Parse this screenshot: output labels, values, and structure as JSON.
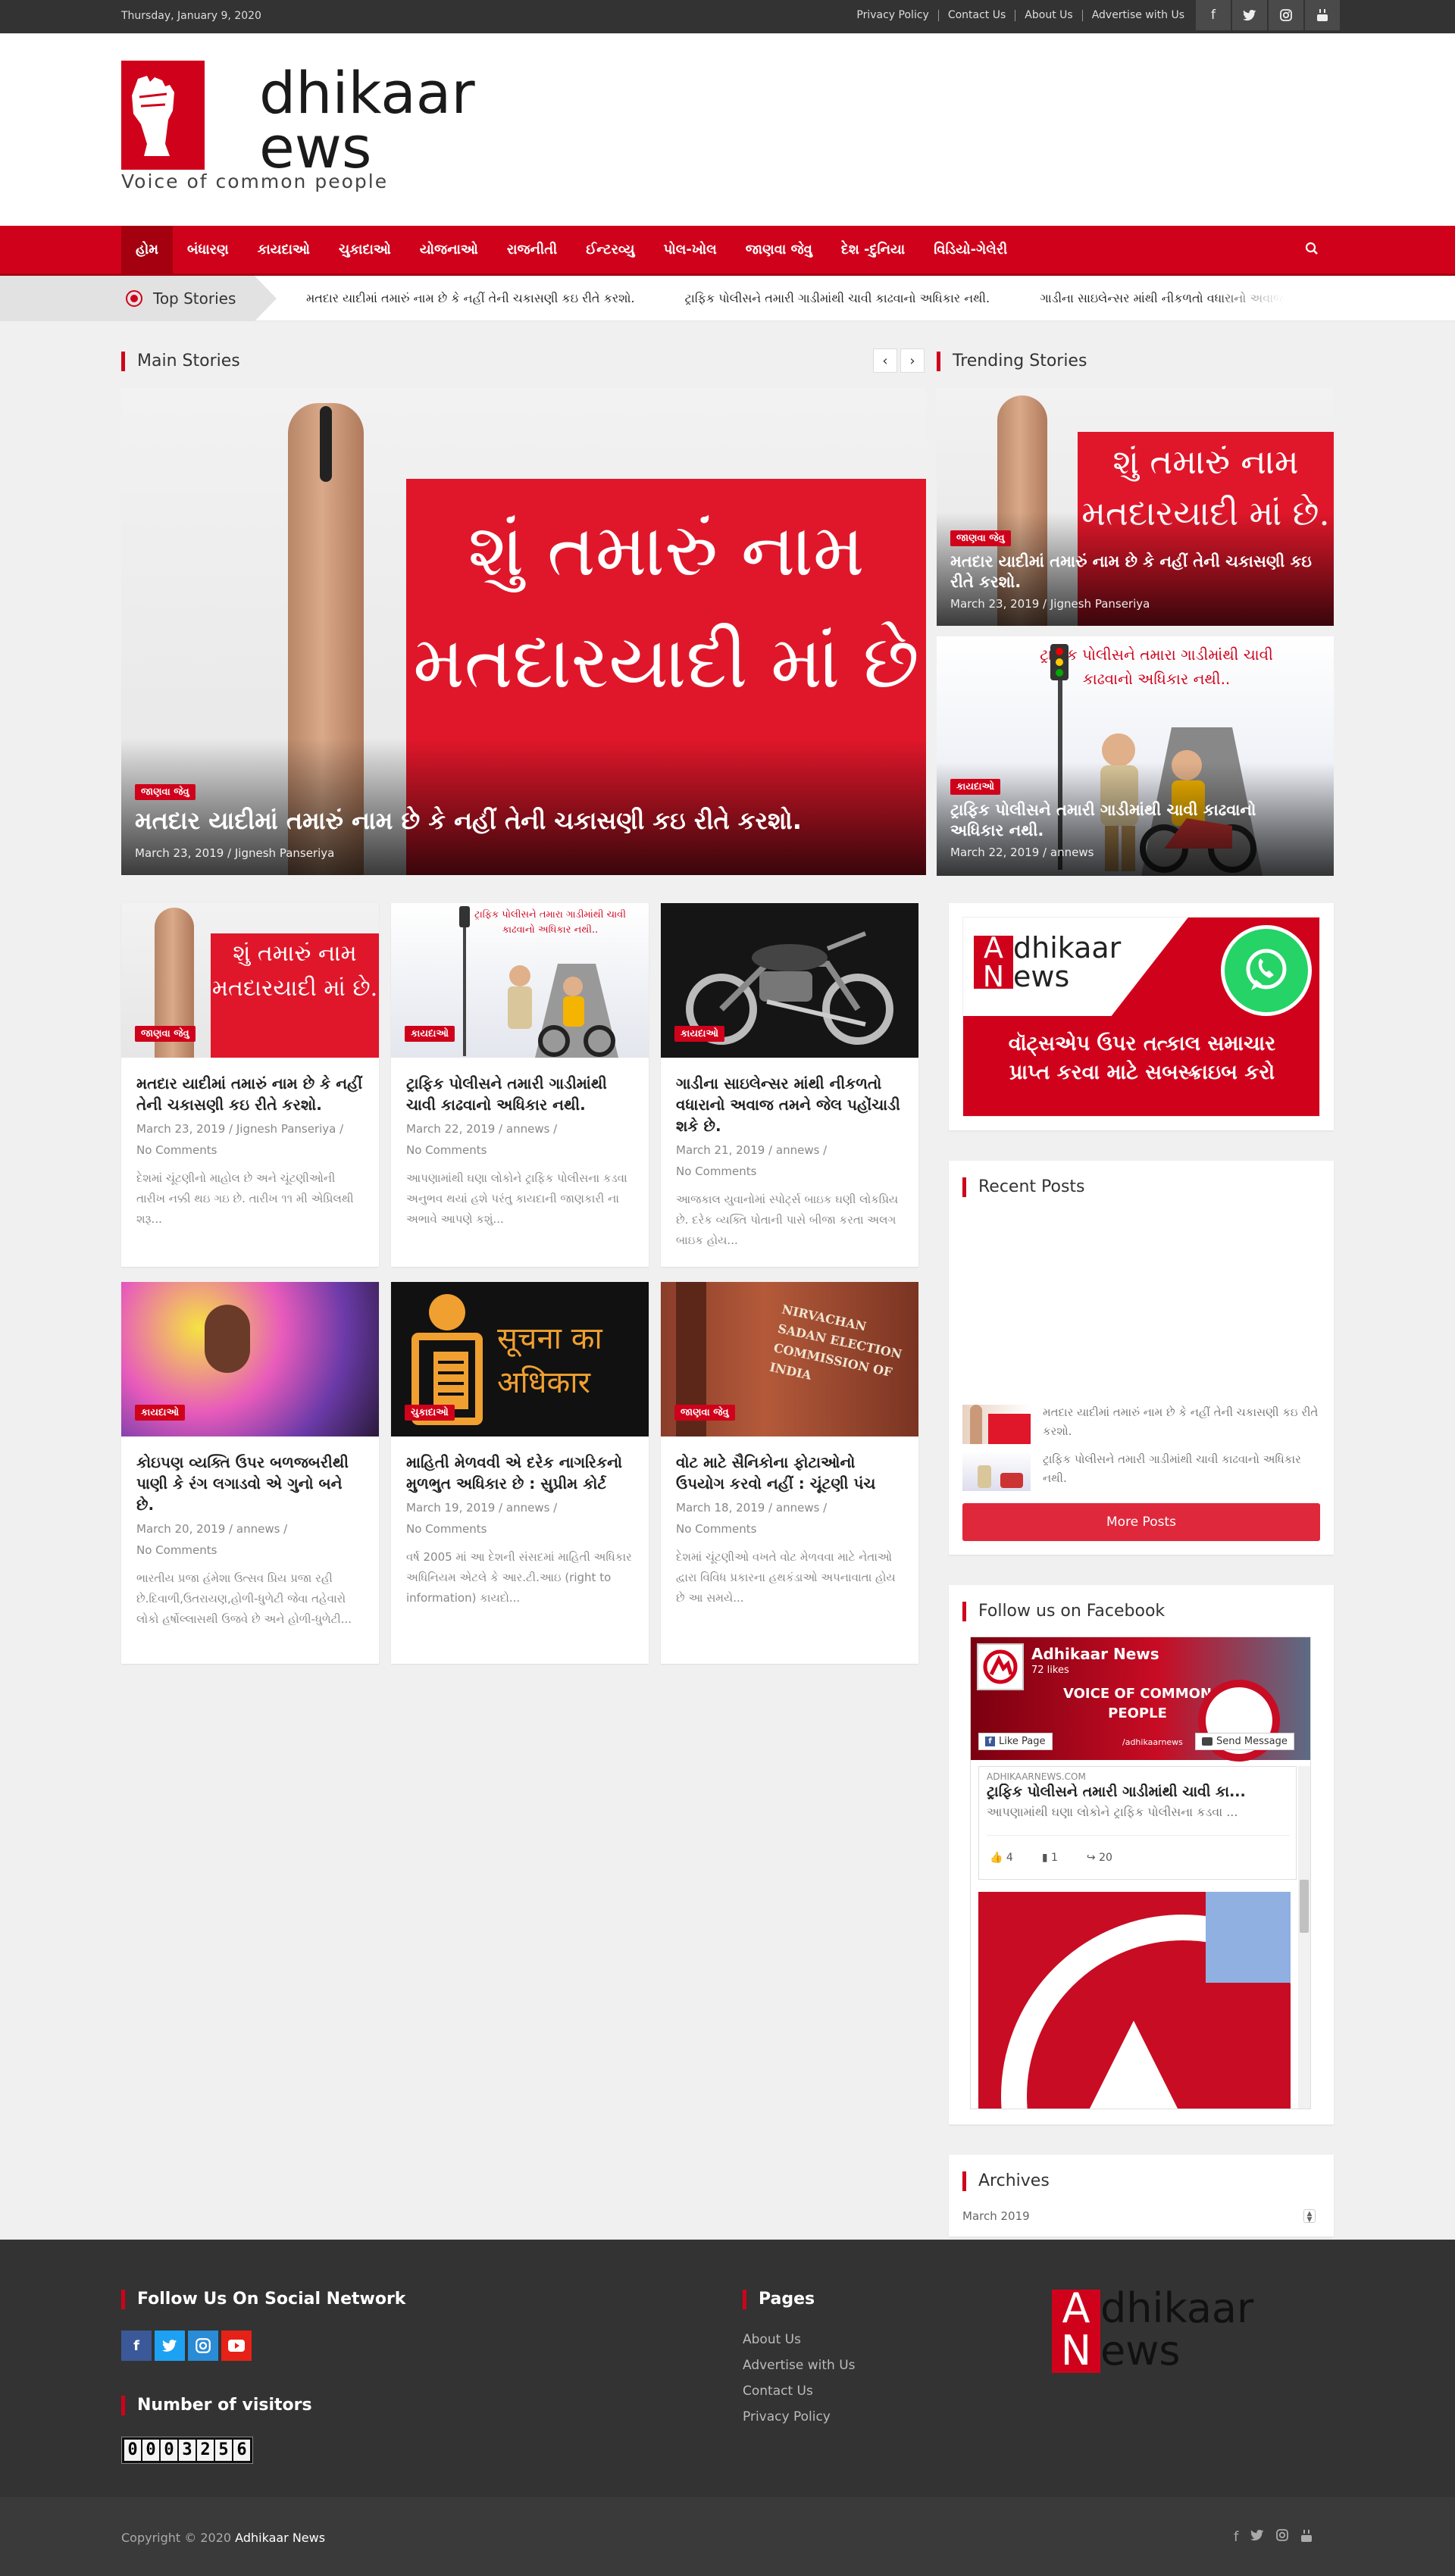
{
  "topbar": {
    "date": "Thursday, January 9, 2020",
    "links": [
      "Privacy Policy",
      "Contact Us",
      "About Us",
      "Advertise with Us"
    ],
    "social_icons": [
      "facebook-icon",
      "twitter-icon",
      "instagram-icon",
      "youtube-icon"
    ]
  },
  "header": {
    "logo_letter_a": "A",
    "logo_rest_a": "dhikaar",
    "logo_letter_n": "N",
    "logo_rest_n": "ews",
    "tagline": "Voice of common people"
  },
  "nav": {
    "items": [
      "હોમ",
      "બંધારણ",
      "કાયદાઓ",
      "ચુકાદાઓ",
      "યોજનાઓ",
      "રાજનીતી",
      "ઈન્ટરવ્યુ",
      "પોલ-ખોલ",
      "જાણવા જેવુ",
      "દેશ -દુનિયા",
      "વિડિયો-ગેલેરી"
    ],
    "search_icon": "search-icon"
  },
  "ticker": {
    "label": "Top Stories",
    "items": [
      "મતદાર યાદીમાં તમારું નામ છે કે નહીં તેની ચકાસણી કઇ રીતે કરશો.",
      "ટ્રાફિક પોલીસને તમારી ગાડીમાંથી ચાવી કાઢવાનો અધિકાર નથી.",
      "ગાડીના સાઇલેન્સર માંથી નીકળતો વધારાનો અવાજ"
    ]
  },
  "main_stories": {
    "title": "Main Stories",
    "hero": {
      "image_text": "શું તમારું નામ મતદારયાદી માં છે",
      "category": "જાણવા જેવુ",
      "headline": "મતદાર યાદીમાં તમારું નામ છે કે નહીં તેની ચકાસણી કઇ રીતે કરશો.",
      "meta": "March 23, 2019 / Jignesh Panseriya"
    }
  },
  "trending": {
    "title": "Trending Stories",
    "items": [
      {
        "image_text": "શું તમારું નામ મતદારયાદી માં છે.",
        "category": "જાણવા જેવુ",
        "headline": "મતદાર યાદીમાં તમારું નામ છે કે નહીં તેની ચકાસણી કઇ રીતે કરશો.",
        "meta": "March 23, 2019 / Jignesh Panseriya"
      },
      {
        "image_text": "ટ્રાફિક પોલીસને તમારા ગાડીમાંથી ચાવી કાઢવાનો અધિકાર નથી..",
        "category": "કાયદાઓ",
        "headline": "ટ્રાફિક પોલીસને તમારી ગાડીમાંથી ચાવી કાઢવાનો અધિકાર નથી.",
        "meta": "March 22, 2019 / annews"
      }
    ]
  },
  "cards": [
    {
      "image_text": "શું તમારું નામ મતદારયાદી માં છે.",
      "category": "જાણવા જેવુ",
      "title": "મતદાર યાદીમાં તમારું નામ છે કે નહીં તેની ચકાસણી કઇ રીતે કરશો.",
      "meta": "March 23, 2019 / Jignesh Panseriya /",
      "comments": "No Comments",
      "excerpt": "દેશમાં ચૂંટણીનો માહોલ છે અને ચૂંટણીઓની તારીખ નક્કી થઇ ગઇ છે. તારીખ ૧૧ મી એપ્રિલથી શરૂ..."
    },
    {
      "image_text": "ટ્રાફિક પોલીસને તમારા ગાડીમાંથી ચાવી કાઢવાનો અધિકાર નથી..",
      "category": "કાયદાઓ",
      "title": "ટ્રાફિક પોલીસને તમારી ગાડીમાંથી ચાવી કાઢવાનો અધિકાર નથી.",
      "meta": "March 22, 2019 / annews /",
      "comments": "No Comments",
      "excerpt": "આપણામાંથી ઘણા લોકોને ટ્રાફિક પોલીસના કડવા અનુભવ થયાં હશે પરંતુ કાયદાની જાણકારી ના અભાવે આપણે કશું..."
    },
    {
      "image_text": "",
      "category": "કાયદાઓ",
      "title": "ગાડીના સાઇલેન્સર માંથી નીકળતો વધારાનો અવાજ તમને જેલ પહોંચાડી શકે છે.",
      "meta": "March 21, 2019 / annews /",
      "comments": "No Comments",
      "excerpt": "આજકાલ યુવાનોમાં સ્પોર્ટ્સ બાઇક ઘણી લોકપ્રિય છે. દરેક વ્યક્તિ પોતાની પાસે બીજા કરતા અલગ બાઇક હોય..."
    },
    {
      "image_text": "",
      "category": "કાયદાઓ",
      "title": "કોઇપણ વ્યક્તિ ઉપર બળજબરીથી પાણી કે રંગ લગાડવો એ ગુનો બને છે.",
      "meta": "March 20, 2019 / annews /",
      "comments": "No Comments",
      "excerpt": "ભારતીય પ્રજા હંમેશા ઉત્સવ પ્રિય પ્રજા રહી છે.દિવાળી,ઉતરાયણ,હોળી-ધુળેટી જેવા તહેવારો લોકો હર્ષોલ્લાસથી ઉજવે છે અને હોળી-ધુળેટી..."
    },
    {
      "image_text": "सूचना का अधिकार",
      "category": "ચુકાદાઓ",
      "title": "માહિતી મેળવવી એ દરેક નાગરિકનો મુળભુત અધિકાર છે : સુપ્રીમ કોર્ટ",
      "meta": "March 19, 2019 / annews /",
      "comments": "No Comments",
      "excerpt": "વર્ષ 2005 માં આ દેશની સંસદમાં માહિતી અધિકાર અધિનિયમ એટલે કે આર.ટી.આઇ (right to information) કાયદો..."
    },
    {
      "image_text": "NIRVACHAN SADAN ELECTION COMMISSION OF INDIA",
      "category": "જાણવા જેવુ",
      "title": "વોટ માટે સૈનિકોના ફોટાઓનો ઉપયોગ કરવો નહીં : ચૂંટણી પંચ",
      "meta": "March 18, 2019 / annews /",
      "comments": "No Comments",
      "excerpt": "દેશમાં ચૂંટણીઓ વખતે વોટ મેળવવા માટે નેતાઓ દ્વારા વિવિધ પ્રકારના હથકંડાઓ અપનાવાતા હોય છે આ સમયે..."
    }
  ],
  "sidebar": {
    "whatsapp_banner": {
      "logo_a": "A",
      "logo_a_rest": "dhikaar",
      "logo_n": "N",
      "logo_n_rest": "ews",
      "text_line1": "વૉટ્સએપ ઉપર તત્કાલ સમાચાર",
      "text_line2": "પ્રાપ્ત કરવા માટે સબસ્ક્રાઇબ કરો"
    },
    "recent_posts": {
      "title": "Recent Posts",
      "items": [
        "મતદાર યાદીમાં તમારું નામ છે કે નહીં તેની ચકાસણી કઇ રીતે કરશો.",
        "ટ્રાફિક પોલીસને તમારી ગાડીમાંથી ચાવી કાઢવાનો અધિકાર નથી."
      ],
      "more_label": "More Posts"
    },
    "facebook": {
      "title": "Follow us on Facebook",
      "page_name": "Adhikaar News",
      "likes": "72 likes",
      "cover_text": "VOICE OF COMMON PEOPLE",
      "like_button": "Like Page",
      "message_button": "Send Message",
      "handle": "/adhikaarnews",
      "post_domain": "ADHIKAARNEWS.COM",
      "post_title": "ટ્રાફિક પોલીસને તમારી ગાડીમાંથી ચાવી કા...",
      "post_excerpt": "આપણામાંથી ઘણા લોકોને ટ્રાફિક પોલીસના કડવા ...",
      "reactions": "4",
      "comments": "1",
      "shares": "20"
    },
    "archives": {
      "title": "Archives",
      "selected": "March 2019"
    }
  },
  "footer": {
    "social_title": "Follow Us On Social Network",
    "social_colors": [
      "#3b5998",
      "#1da1f2",
      "#2a8bd6",
      "#e62117"
    ],
    "visitors_title": "Number of visitors",
    "visitor_digits": [
      "0",
      "0",
      "0",
      "3",
      "2",
      "5",
      "6"
    ],
    "pages_title": "Pages",
    "pages": [
      "About Us",
      "Advertise with Us",
      "Contact Us",
      "Privacy Policy"
    ],
    "logo_a": "A",
    "logo_a_rest": "dhikaar",
    "logo_n": "N",
    "logo_n_rest": "ews",
    "copyright_prefix": "Copyright © 2020",
    "copyright_brand": "Adhikaar News"
  },
  "colors": {
    "brand_red": "#d0021b",
    "dark": "#333333"
  }
}
